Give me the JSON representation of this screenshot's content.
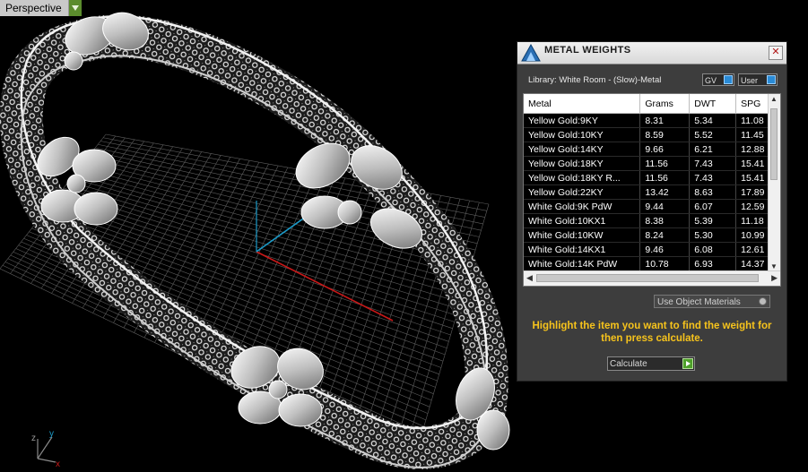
{
  "viewport": {
    "label": "Perspective",
    "axes": {
      "x": "x",
      "y": "y",
      "z": "z"
    }
  },
  "dialog": {
    "title": "METAL WEIGHTS",
    "library": "Library: White Room - (Slow)-Metal",
    "gv_select": "GV",
    "user_select": "User",
    "columns": [
      "Metal",
      "Grams",
      "DWT",
      "SPG"
    ],
    "rows": [
      [
        "Yellow Gold:9KY",
        "8.31",
        "5.34",
        "11.08"
      ],
      [
        "Yellow Gold:10KY",
        "8.59",
        "5.52",
        "11.45"
      ],
      [
        "Yellow Gold:14KY",
        "9.66",
        "6.21",
        "12.88"
      ],
      [
        "Yellow Gold:18KY",
        "11.56",
        "7.43",
        "15.41"
      ],
      [
        "Yellow Gold:18KY R...",
        "11.56",
        "7.43",
        "15.41"
      ],
      [
        "Yellow Gold:22KY",
        "13.42",
        "8.63",
        "17.89"
      ],
      [
        "White Gold:9K PdW",
        "9.44",
        "6.07",
        "12.59"
      ],
      [
        "White Gold:10KX1",
        "8.38",
        "5.39",
        "11.18"
      ],
      [
        "White Gold:10KW",
        "8.24",
        "5.30",
        "10.99"
      ],
      [
        "White Gold:14KX1",
        "9.46",
        "6.08",
        "12.61"
      ],
      [
        "White Gold:14K PdW",
        "10.78",
        "6.93",
        "14.37"
      ]
    ],
    "use_object_materials": "Use Object Materials",
    "instructions": "Highlight the item you want to find the weight for then press calculate.",
    "calculate": "Calculate"
  },
  "colors": {
    "instructions": "#f6c31c",
    "accent_green": "#5b8c2d",
    "axis_x": "#c81818",
    "axis_y": "#1a9ac8",
    "grid": "#6a6a6a"
  }
}
